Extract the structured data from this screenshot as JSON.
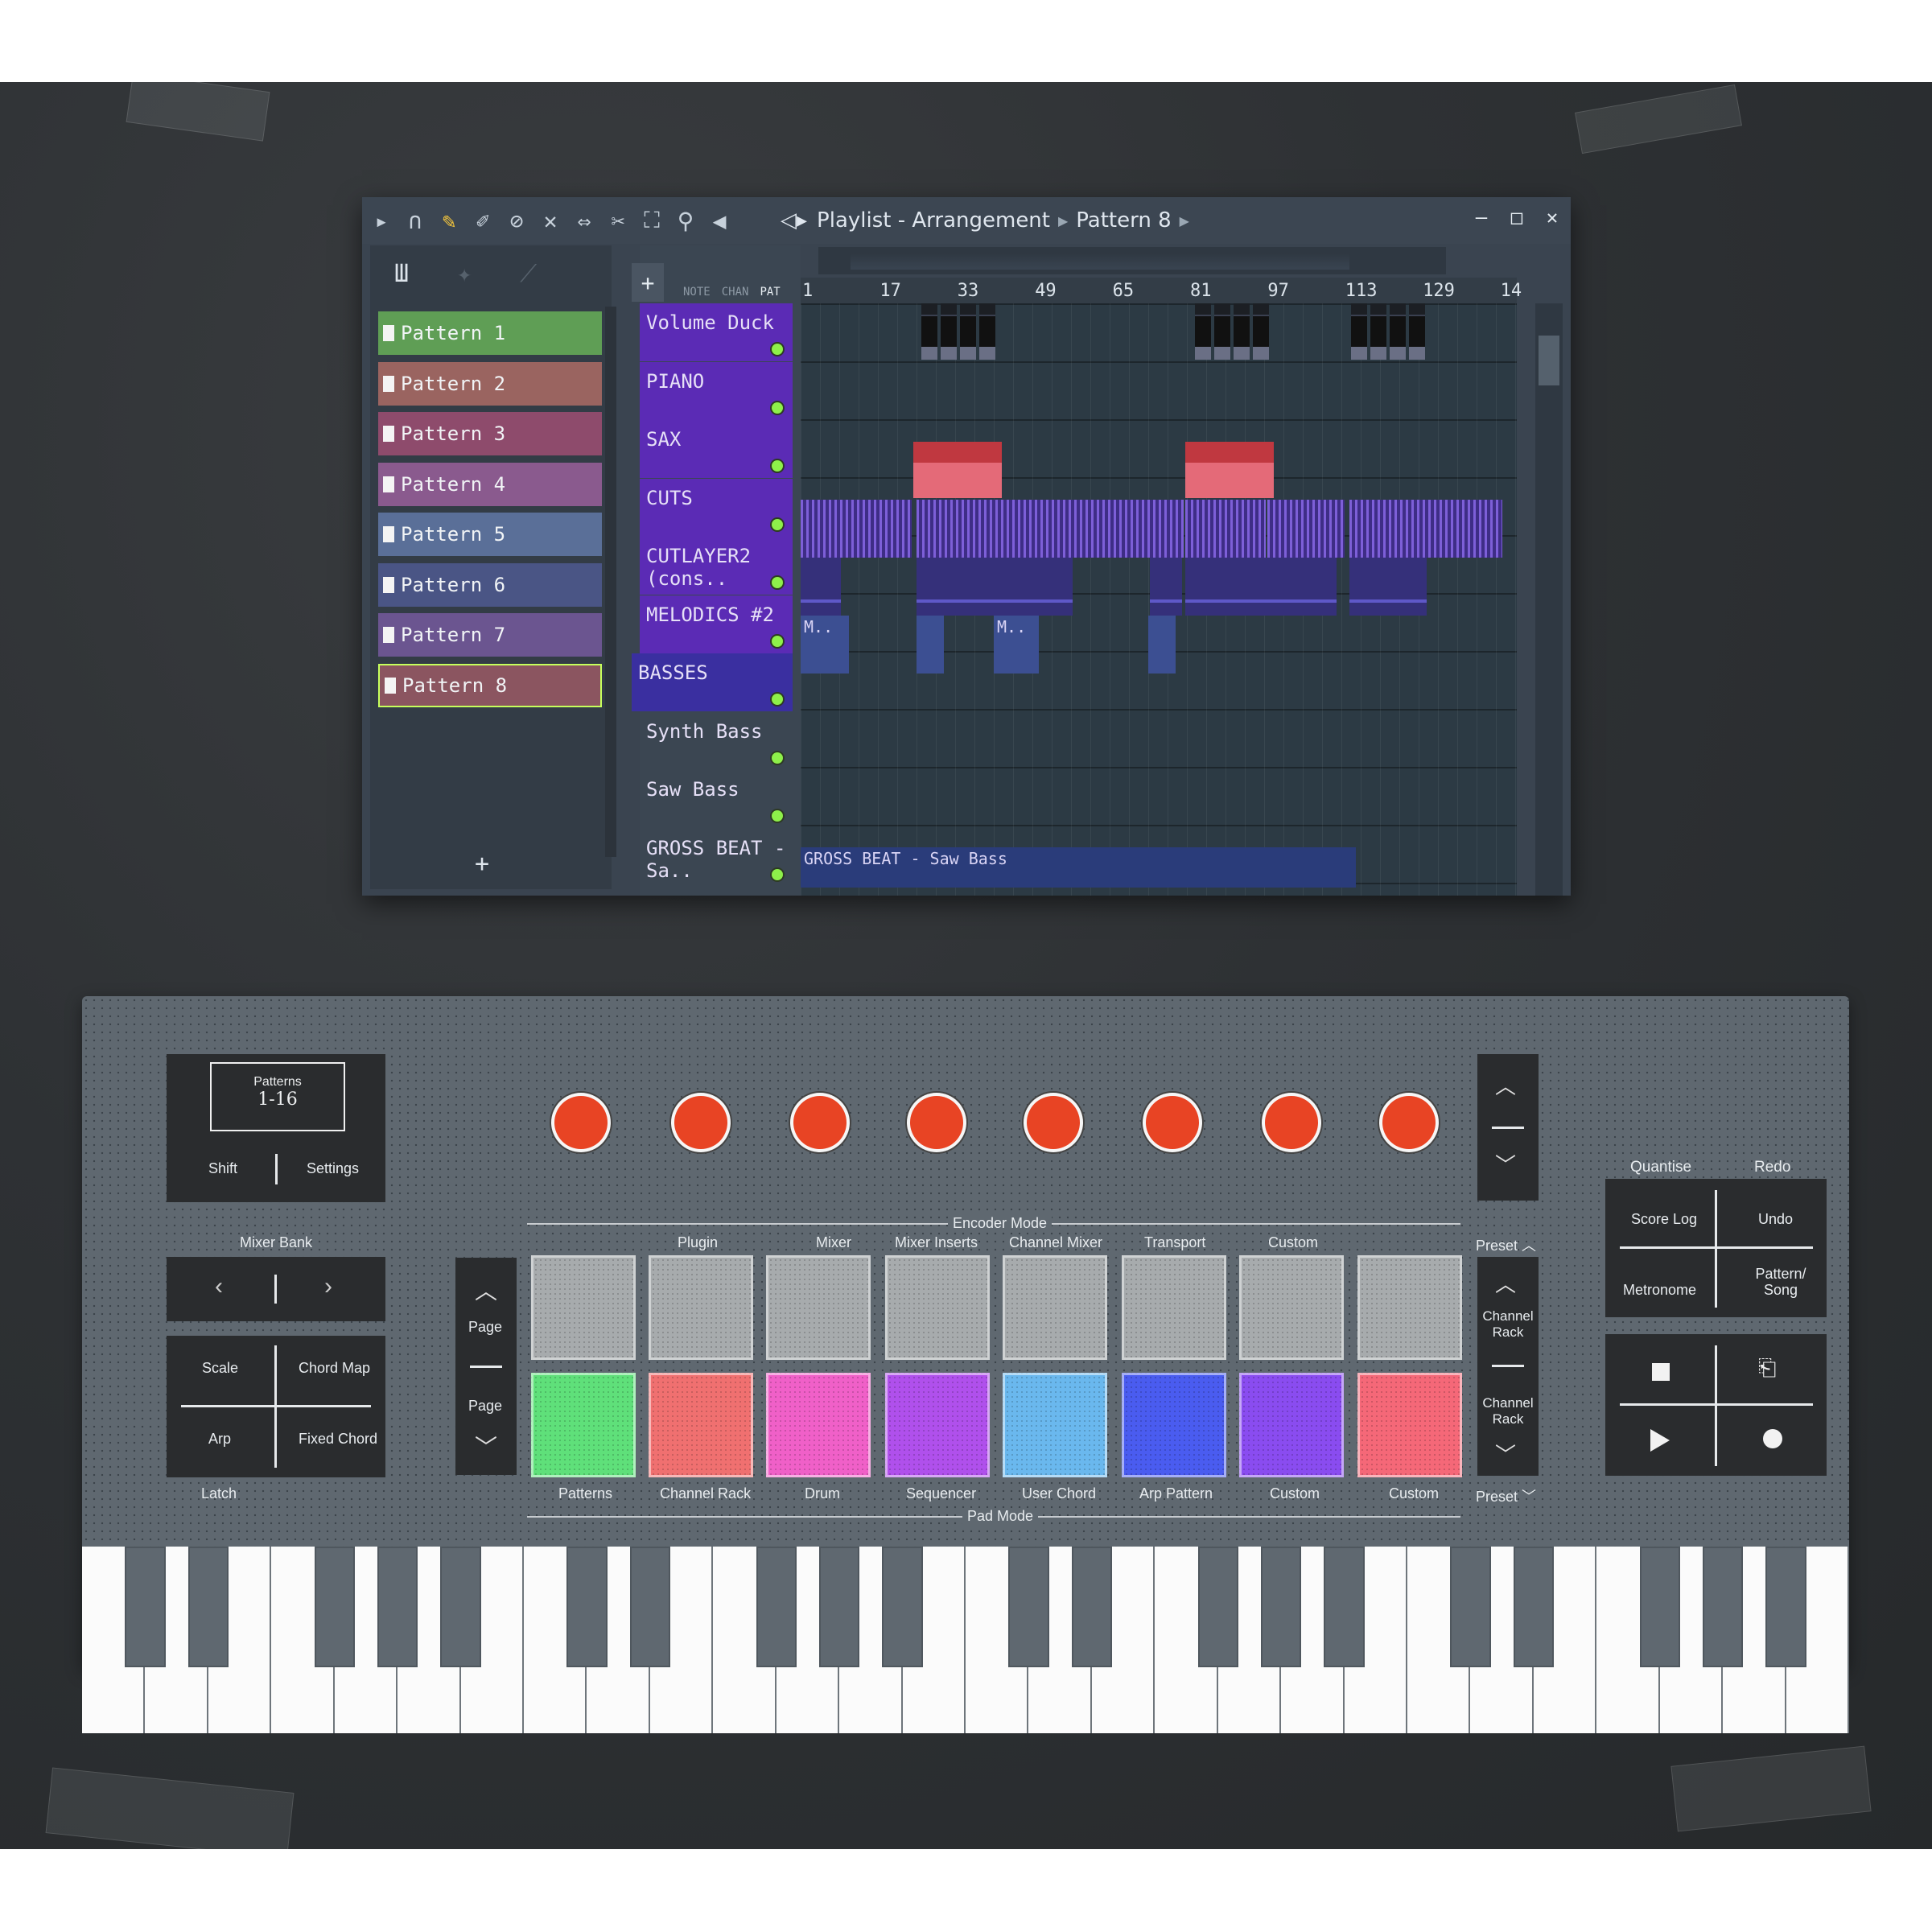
{
  "window": {
    "title": "Playlist - Arrangement",
    "pattern": "Pattern 8",
    "controls": {
      "minimize": "–",
      "maximize": "□",
      "close": "✕"
    }
  },
  "left_panel": {
    "add_label": "+",
    "patterns": [
      {
        "label": "Pattern 1",
        "color": "#5f9e55"
      },
      {
        "label": "Pattern 2",
        "color": "#9a6460"
      },
      {
        "label": "Pattern 3",
        "color": "#8e4b6c"
      },
      {
        "label": "Pattern 4",
        "color": "#8a5a8e"
      },
      {
        "label": "Pattern 5",
        "color": "#5a6f98"
      },
      {
        "label": "Pattern 6",
        "color": "#4a5585"
      },
      {
        "label": "Pattern 7",
        "color": "#6b5590"
      },
      {
        "label": "Pattern 8",
        "color": "#8b5560",
        "selected": true
      }
    ]
  },
  "mode_buttons": {
    "note": "NOTE",
    "chan": "CHAN",
    "pat": "PAT",
    "add": "+"
  },
  "ruler": [
    "1",
    "17",
    "33",
    "49",
    "65",
    "81",
    "97",
    "113",
    "129",
    "14"
  ],
  "tracks": [
    {
      "name": "Volume Duck",
      "style": "purple"
    },
    {
      "name": "PIANO",
      "style": "purple"
    },
    {
      "name": "SAX",
      "style": "purple"
    },
    {
      "name": "CUTS",
      "style": "purple"
    },
    {
      "name": "CUTLAYER2 (cons..",
      "style": "purple"
    },
    {
      "name": "MELODICS #2",
      "style": "purple"
    },
    {
      "name": "BASSES",
      "style": "group"
    },
    {
      "name": "Synth Bass",
      "style": "plain"
    },
    {
      "name": "Saw Bass",
      "style": "plain"
    },
    {
      "name": "GROSS BEAT - Sa..",
      "style": "plain"
    }
  ],
  "clips": {
    "melodic_label": "M..",
    "gross_beat_label": "GROSS BEAT - Saw Bass"
  },
  "hardware": {
    "screen": {
      "title": "Patterns",
      "value": "1-16"
    },
    "shift": "Shift",
    "settings": "Settings",
    "mixer_bank": "Mixer Bank",
    "scale": "Scale",
    "chord_map": "Chord Map",
    "arp": "Arp",
    "fixed_chord": "Fixed Chord",
    "latch": "Latch",
    "page_up": "Page",
    "page_down": "Page",
    "encoder_mode": "Encoder Mode",
    "encoder_labels": [
      "Plugin",
      "Mixer",
      "Mixer Inserts",
      "Channel Mixer",
      "Transport",
      "Custom"
    ],
    "pad_mode": "Pad Mode",
    "pad_labels": [
      "Patterns",
      "Channel Rack",
      "Drum",
      "Sequencer",
      "User Chord",
      "Arp Pattern",
      "Custom",
      "Custom"
    ],
    "pad_colors": [
      "#5fe07a",
      "#f07070",
      "#f060c8",
      "#b050ec",
      "#6ab8ee",
      "#4a5cf0",
      "#8a4cf0",
      "#f56878"
    ],
    "preset_up": "Preset",
    "preset_down": "Preset",
    "channel_rack_up": "Channel Rack",
    "channel_rack_down": "Channel Rack",
    "quantise": "Quantise",
    "redo": "Redo",
    "score_log": "Score Log",
    "undo": "Undo",
    "metronome": "Metronome",
    "pattern_song": "Pattern/ Song",
    "knob_color": "#e84424"
  }
}
